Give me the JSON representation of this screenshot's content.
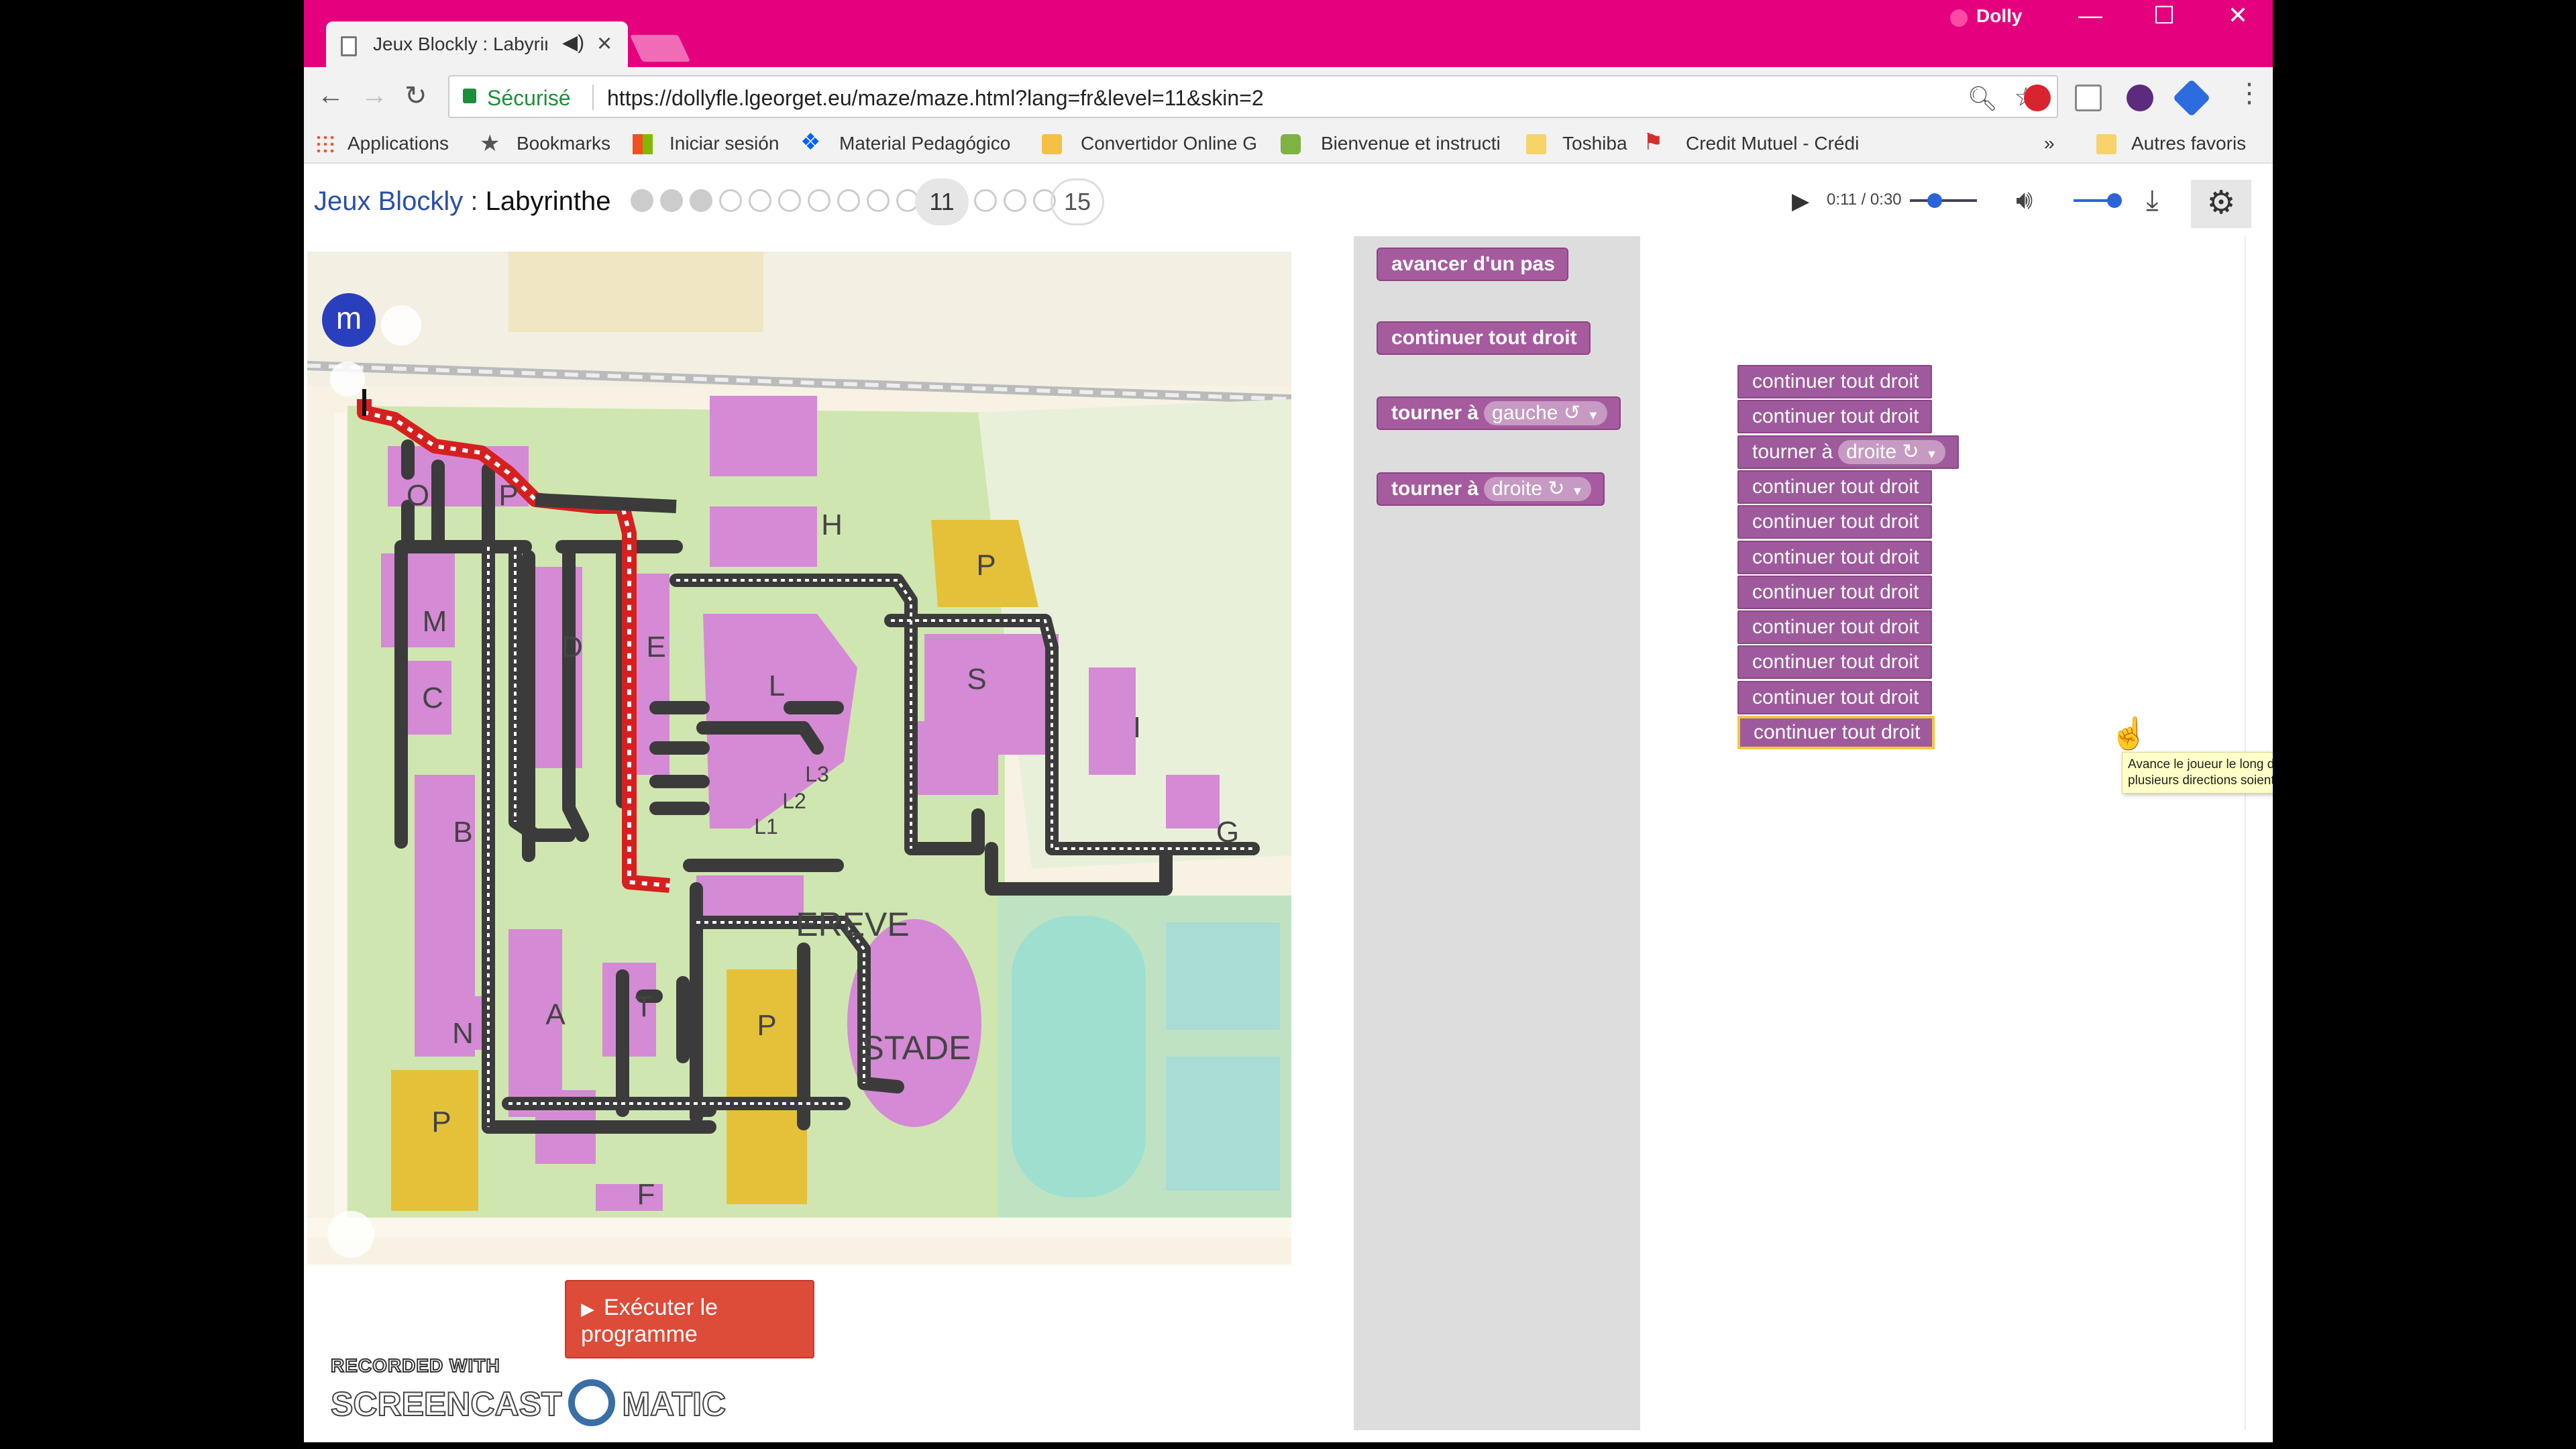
{
  "browser": {
    "tab_title": "Jeux Blockly : Labyrinthe",
    "audio_indicator": "◀)",
    "user_name": "Dolly",
    "secure_label": "Sécurisé",
    "url": "https://dollyfle.lgeorget.eu/maze/maze.html?lang=fr&level=11&skin=2",
    "bookmarks": {
      "apps": "Applications",
      "bookmarks": "Bookmarks",
      "iniciar": "Iniciar sesión",
      "material": "Material Pedagógico",
      "convertidor": "Convertidor Online G",
      "bienvenue": "Bienvenue et instructi",
      "toshiba": "Toshiba",
      "credit": "Credit Mutuel - Crédi",
      "more": "»",
      "other": "Autres favoris"
    }
  },
  "app": {
    "brand": "Jeux Blockly",
    "separator": " : ",
    "game": "Labyrinthe",
    "levels": {
      "total": 15,
      "current": "11",
      "last": "15",
      "completed": 3
    }
  },
  "video": {
    "time": "0:11 / 0:30",
    "progress": 0.37
  },
  "map": {
    "avatar_letter": "m",
    "labels": [
      "O",
      "P",
      "H",
      "P",
      "M",
      "D",
      "E",
      "L",
      "S",
      "C",
      "I",
      "L3",
      "L2",
      "L1",
      "B",
      "G",
      "EREVE",
      "N",
      "A",
      "T",
      "P",
      "STADE",
      "P",
      "F"
    ],
    "colors": {
      "grass": "#cfe6b0",
      "building": "#d58ad5",
      "parking": "#e5c13a",
      "road": "#f7f2e3",
      "track": "#ffffff",
      "path": "#d62020"
    }
  },
  "run_button": {
    "label_line1": "Exécuter le",
    "label_line2": "programme"
  },
  "watermark": {
    "recorded": "RECORDED WITH",
    "brand_left": "SCREENCAST",
    "brand_right": "MATIC"
  },
  "toolbox": {
    "move": "avancer d'un pas",
    "straight": "continuer tout droit",
    "turn_left_prefix": "tourner à",
    "turn_left_value": "gauche ↺",
    "turn_right_prefix": "tourner à",
    "turn_right_value": "droite ↻"
  },
  "workspace": {
    "blocks": [
      {
        "text": "continuer tout droit"
      },
      {
        "text": "continuer tout droit"
      },
      {
        "text": "tourner à",
        "value": "droite ↻"
      },
      {
        "text": "continuer tout droit"
      },
      {
        "text": "continuer tout droit"
      },
      {
        "text": "continuer tout droit"
      },
      {
        "text": "continuer tout droit"
      },
      {
        "text": "continuer tout droit"
      },
      {
        "text": "continuer tout droit"
      },
      {
        "text": "continuer tout droit"
      },
      {
        "text": "continuer tout droit"
      }
    ],
    "tooltip": "Avance le joueur le long de la route jusqu'à ce que plusieurs directions soient disponibles"
  },
  "colors": {
    "titlebar": "#e5007e",
    "block": "#a55b9d",
    "run_button": "#dd4b39",
    "brand_link": "#2a4fa8"
  }
}
